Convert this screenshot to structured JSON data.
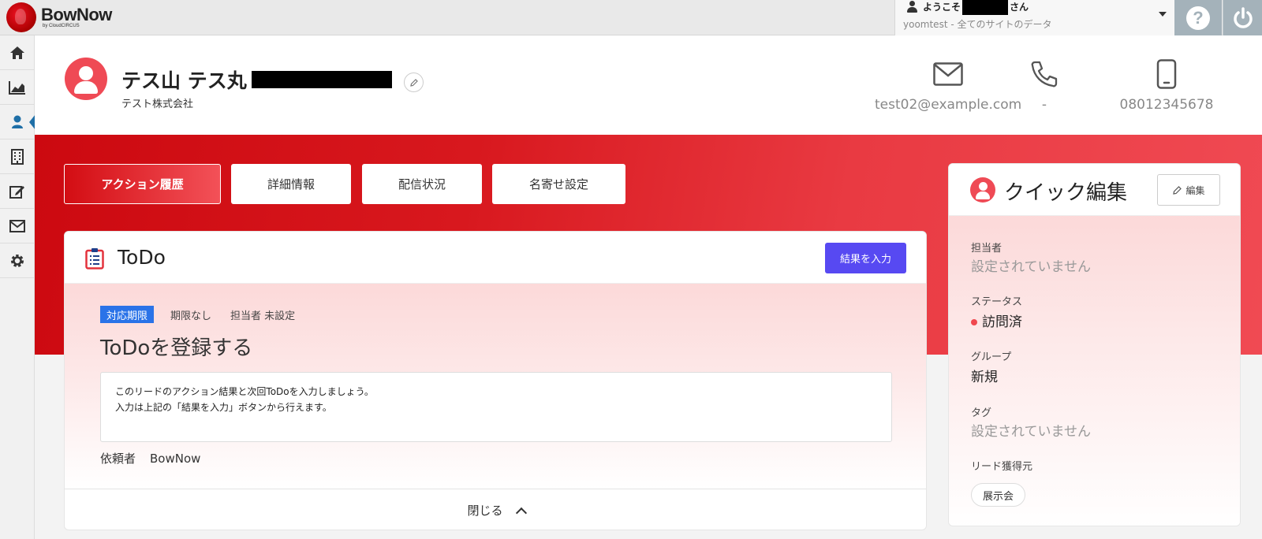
{
  "app": {
    "brand": "BowNow",
    "brand_sub": "by CloudCIRCUS",
    "welcome_prefix": "ようこそ",
    "welcome_suffix": "さん",
    "site_scope": "yoomtest - 全てのサイトのデータ",
    "help_glyph": "?"
  },
  "sidebar": {
    "items": [
      {
        "icon": "home-icon"
      },
      {
        "icon": "chart-icon"
      },
      {
        "icon": "user-icon",
        "active": true
      },
      {
        "icon": "building-icon"
      },
      {
        "icon": "edit-note-icon"
      },
      {
        "icon": "mail-icon"
      },
      {
        "icon": "gear-icon"
      }
    ]
  },
  "lead": {
    "name": "テス山 テス丸",
    "company": "テスト株式会社",
    "email": "test02@example.com",
    "phone": "-",
    "mobile": "08012345678"
  },
  "tabs": [
    {
      "label": "アクション履歴",
      "active": true
    },
    {
      "label": "詳細情報"
    },
    {
      "label": "配信状況"
    },
    {
      "label": "名寄せ設定"
    }
  ],
  "todo": {
    "title": "ToDo",
    "result_button": "結果を入力",
    "deadline_badge": "対応期限",
    "deadline_value": "期限なし",
    "assignee": "担当者 未設定",
    "heading": "ToDoを登録する",
    "note_line1": "このリードのアクション結果と次回ToDoを入力しましょう。",
    "note_line2": "入力は上記の「結果を入力」ボタンから行えます。",
    "requester_label": "依頼者",
    "requester_value": "BowNow",
    "close_label": "閉じる"
  },
  "quick_edit": {
    "title": "クイック編集",
    "edit_button": "編集",
    "fields": {
      "owner_label": "担当者",
      "owner_value": "設定されていません",
      "status_label": "ステータス",
      "status_value": "訪問済",
      "group_label": "グループ",
      "group_value": "新規",
      "tag_label": "タグ",
      "tag_value": "設定されていません",
      "source_label": "リード獲得元",
      "source_value": "展示会"
    }
  },
  "colors": {
    "brand_red": "#d30d13",
    "accent_blue": "#5749f2",
    "badge_blue": "#2a73e8",
    "status_dot": "#f0484f"
  }
}
